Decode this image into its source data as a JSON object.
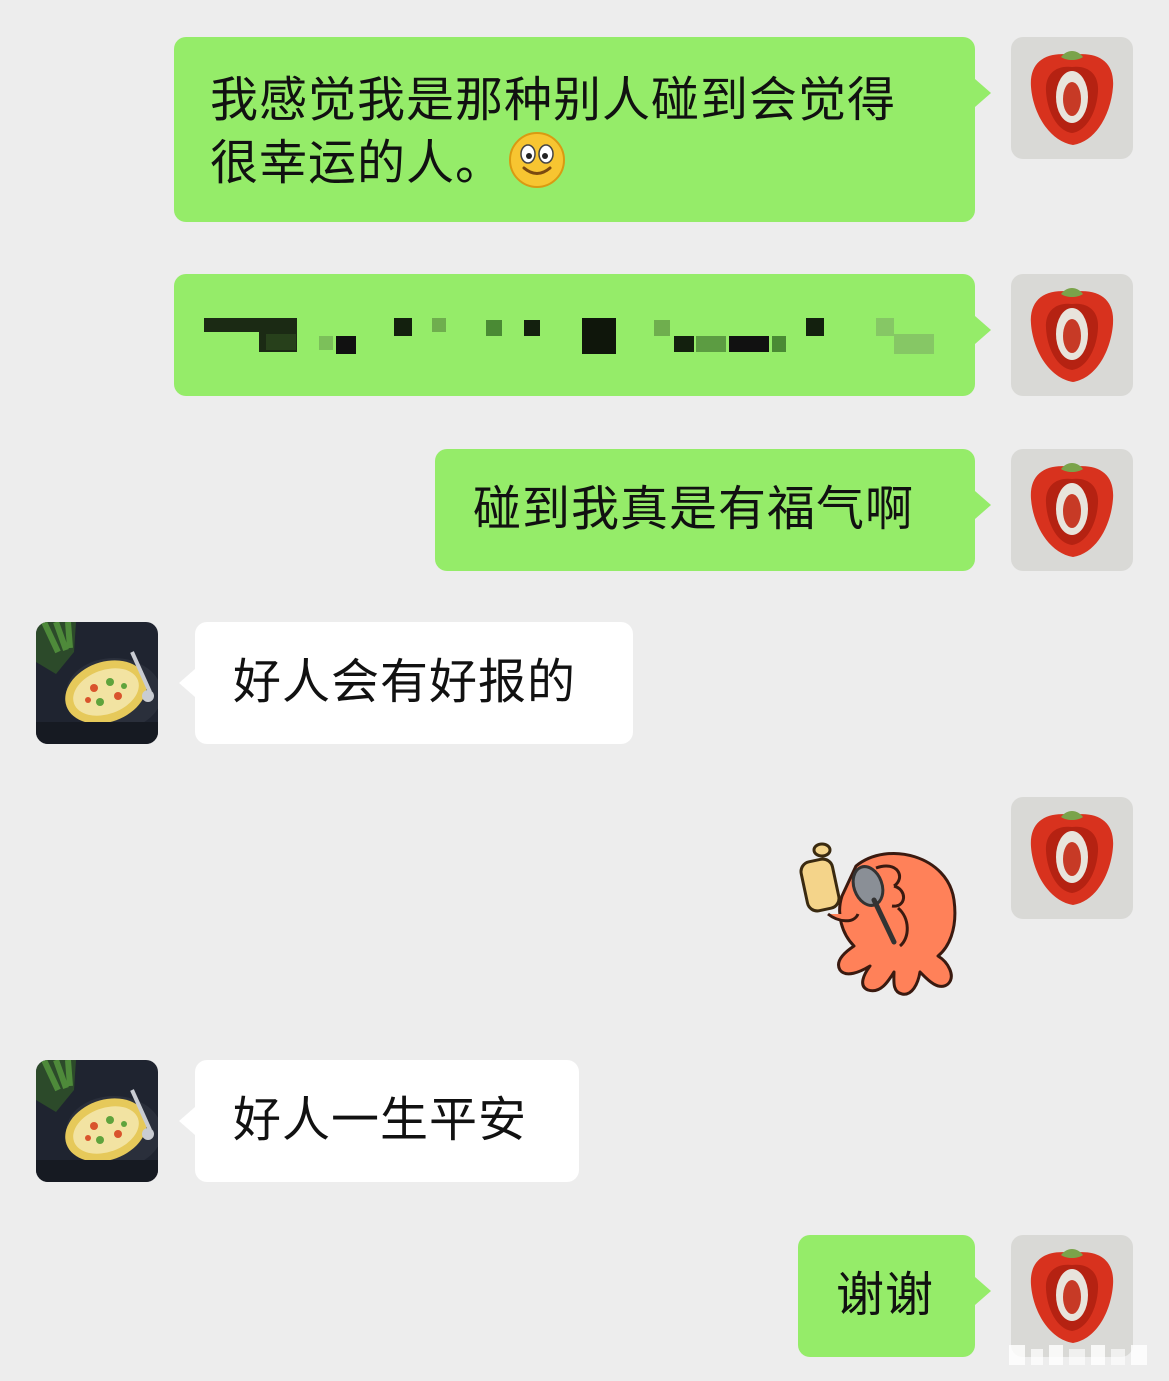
{
  "colors": {
    "background": "#ededed",
    "sent_bubble": "#95ec69",
    "received_bubble": "#ffffff"
  },
  "messages": [
    {
      "side": "me",
      "text": "我感觉我是那种别人碰到会觉得很幸运的人。",
      "emoji": "smiley-face-icon"
    },
    {
      "side": "me",
      "content": "pixelated-redacted-text"
    },
    {
      "side": "me",
      "text": "碰到我真是有福气啊"
    },
    {
      "side": "them",
      "text": "好人会有好报的"
    },
    {
      "side": "me",
      "content": "octopus-eating-sticker"
    },
    {
      "side": "them",
      "text": "好人一生平安"
    },
    {
      "side": "me",
      "text": "谢谢"
    }
  ],
  "avatars": {
    "me": "bell-pepper-avatar",
    "them": "pineapple-rice-avatar"
  }
}
